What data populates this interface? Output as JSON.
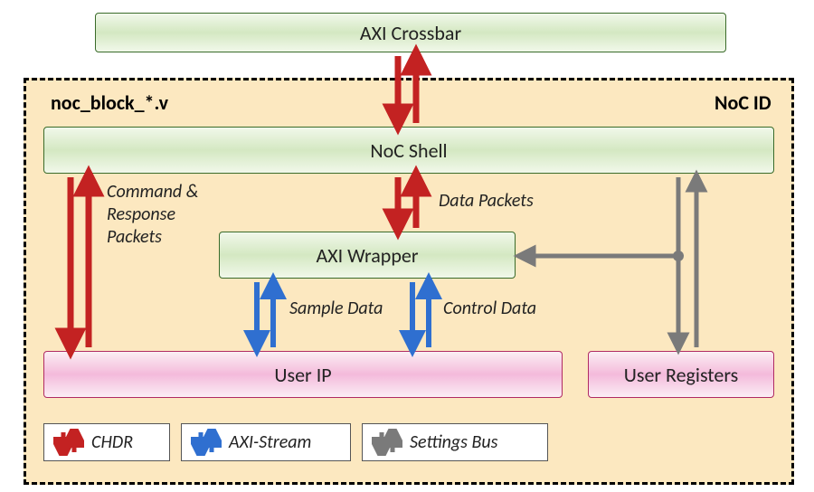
{
  "blocks": {
    "crossbar": "AXI Crossbar",
    "noc_shell": "NoC Shell",
    "axi_wrapper": "AXI Wrapper",
    "user_ip": "User IP",
    "user_registers": "User Registers"
  },
  "headings": {
    "noc_block": "noc_block_*.v",
    "noc_id": "NoC ID"
  },
  "labels": {
    "cmd_resp": "Command &\nResponse\nPackets",
    "data_packets": "Data Packets",
    "sample_data": "Sample Data",
    "control_data": "Control Data"
  },
  "legend": {
    "chdr": "CHDR",
    "axi_stream": "AXI-Stream",
    "settings_bus": "Settings Bus"
  },
  "colors": {
    "red": "#c32222",
    "blue": "#2f6fd0",
    "gray": "#7a7a7a"
  }
}
